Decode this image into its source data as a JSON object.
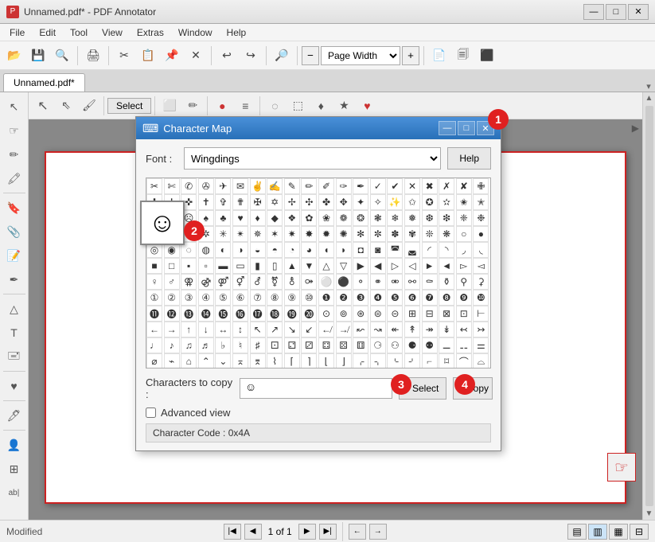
{
  "window": {
    "title": "Unnamed.pdf* - PDF Annotator",
    "icon": "pdf"
  },
  "title_controls": {
    "minimize": "—",
    "maximize": "□",
    "close": "✕"
  },
  "menu": {
    "items": [
      "File",
      "Edit",
      "Tool",
      "View",
      "Extras",
      "Window",
      "Help"
    ]
  },
  "toolbar": {
    "page_width_label": "Page Width",
    "page_width_option": "Page Width"
  },
  "tab": {
    "name": "Unnamed.pdf*"
  },
  "select_btn": "Select",
  "status": {
    "text": "Modified",
    "page_current": "1",
    "page_total": "1 of 1"
  },
  "dialog": {
    "title": "Character Map",
    "font_label": "Font :",
    "font_value": "Wingdings",
    "help_btn": "Help",
    "characters_to_copy_label": "Characters to copy :",
    "characters_to_copy_value": "☺",
    "select_btn": "Select",
    "copy_btn": "Copy",
    "advanced_view_label": "Advanced view",
    "char_code_label": "Character Code : 0x4A",
    "preview_char": "☺",
    "step1_badge": "1",
    "step2_badge": "2",
    "step3_badge": "3",
    "step4_badge": "4"
  },
  "symbols": [
    "✂",
    "✄",
    "✆",
    "✇",
    "✈",
    "✉",
    "✌",
    "✍",
    "✎",
    "✏",
    "✐",
    "✑",
    "✒",
    "✓",
    "✔",
    "✕",
    "✖",
    "✗",
    "✘",
    "✙",
    "✚",
    "✛",
    "✜",
    "✝",
    "✞",
    "✟",
    "✠",
    "✡",
    "✢",
    "✣",
    "✤",
    "✥",
    "✦",
    "✧",
    "✨",
    "✩",
    "✪",
    "✫",
    "✬",
    "✭",
    "☺",
    "☻",
    "☹",
    "♠",
    "♣",
    "♥",
    "♦",
    "◆",
    "❖",
    "✿",
    "❀",
    "❁",
    "❂",
    "❃",
    "❄",
    "❅",
    "❆",
    "❇",
    "❈",
    "❉",
    "★",
    "☆",
    "✱",
    "✲",
    "✳",
    "✴",
    "✵",
    "✶",
    "✷",
    "✸",
    "✹",
    "✺",
    "✻",
    "✼",
    "✽",
    "✾",
    "❊",
    "❋",
    "○",
    "●",
    "◎",
    "◉",
    "◌",
    "◍",
    "◐",
    "◑",
    "◒",
    "◓",
    "◔",
    "◕",
    "◖",
    "◗",
    "◘",
    "◙",
    "◚",
    "◛",
    "◜",
    "◝",
    "◞",
    "◟",
    "■",
    "□",
    "▪",
    "▫",
    "▬",
    "▭",
    "▮",
    "▯",
    "▲",
    "▼",
    "△",
    "▽",
    "▶",
    "◀",
    "▷",
    "◁",
    "►",
    "◄",
    "▻",
    "◅",
    "♀",
    "♂",
    "⚢",
    "⚣",
    "⚤",
    "⚥",
    "⚦",
    "⚧",
    "⚨",
    "⚩",
    "⚪",
    "⚫",
    "⚬",
    "⚭",
    "⚮",
    "⚯",
    "⚰",
    "⚱",
    "⚲",
    "⚳",
    "①",
    "②",
    "③",
    "④",
    "⑤",
    "⑥",
    "⑦",
    "⑧",
    "⑨",
    "⑩",
    "❶",
    "❷",
    "❸",
    "❹",
    "❺",
    "❻",
    "❼",
    "❽",
    "❾",
    "❿",
    "⓫",
    "⓬",
    "⓭",
    "⓮",
    "⓯",
    "⓰",
    "⓱",
    "⓲",
    "⓳",
    "⓴",
    "⊙",
    "⊚",
    "⊛",
    "⊜",
    "⊝",
    "⊞",
    "⊟",
    "⊠",
    "⊡",
    "⊢",
    "←",
    "→",
    "↑",
    "↓",
    "↔",
    "↕",
    "↖",
    "↗",
    "↘",
    "↙",
    "↚",
    "↛",
    "↜",
    "↝",
    "↞",
    "↟",
    "↠",
    "↡",
    "↢",
    "↣",
    "♩",
    "♪",
    "♫",
    "♬",
    "♭",
    "♮",
    "♯",
    "⚀",
    "⚁",
    "⚂",
    "⚃",
    "⚄",
    "⚅",
    "⚆",
    "⚇",
    "⚈",
    "⚉",
    "⚊",
    "⚋",
    "⚌",
    "⌀",
    "⌁",
    "⌂",
    "⌃",
    "⌄",
    "⌅",
    "⌆",
    "⌇",
    "⌈",
    "⌉",
    "⌊",
    "⌋",
    "⌌",
    "⌍",
    "⌎",
    "⌏",
    "⌐",
    "⌑",
    "⌒",
    "⌓"
  ]
}
